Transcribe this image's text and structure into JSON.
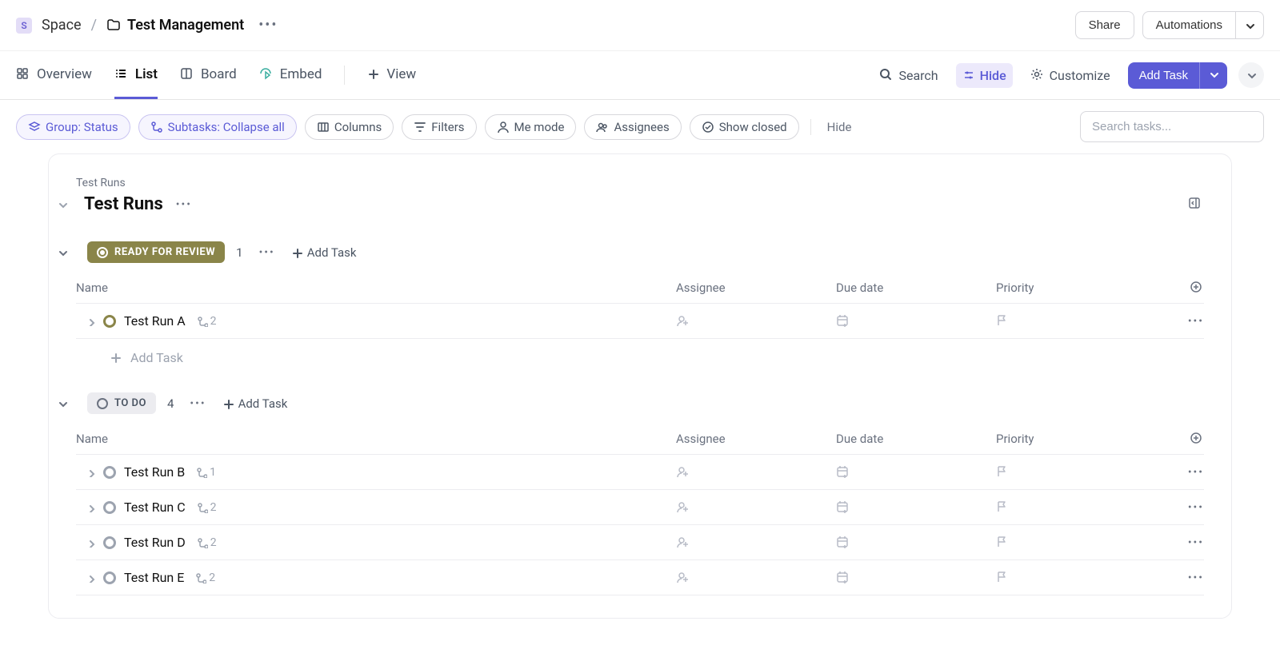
{
  "breadcrumb": {
    "space_badge": "S",
    "space_label": "Space",
    "folder_label": "Test Management"
  },
  "topbar": {
    "share_label": "Share",
    "automations_label": "Automations"
  },
  "viewtabs": {
    "overview": "Overview",
    "list": "List",
    "board": "Board",
    "embed": "Embed",
    "add_view": "View",
    "search": "Search",
    "hide": "Hide",
    "customize": "Customize",
    "add_task": "Add Task"
  },
  "filters": {
    "group": "Group: Status",
    "subtasks": "Subtasks: Collapse all",
    "columns": "Columns",
    "filters": "Filters",
    "me_mode": "Me mode",
    "assignees": "Assignees",
    "show_closed": "Show closed",
    "hide": "Hide",
    "search_placeholder": "Search tasks..."
  },
  "folder": {
    "crumb": "Test Runs",
    "title": "Test Runs"
  },
  "columns": {
    "name": "Name",
    "assignee": "Assignee",
    "due_date": "Due date",
    "priority": "Priority"
  },
  "groups": [
    {
      "status_label": "READY FOR REVIEW",
      "status_class": "review",
      "count": "1",
      "add_label": "Add Task",
      "tasks": [
        {
          "name": "Test Run A",
          "subtasks": "2",
          "status": "review"
        }
      ],
      "footer_add": "Add Task"
    },
    {
      "status_label": "TO DO",
      "status_class": "todo",
      "count": "4",
      "add_label": "Add Task",
      "tasks": [
        {
          "name": "Test Run B",
          "subtasks": "1",
          "status": "todo"
        },
        {
          "name": "Test Run C",
          "subtasks": "2",
          "status": "todo"
        },
        {
          "name": "Test Run D",
          "subtasks": "2",
          "status": "todo"
        },
        {
          "name": "Test Run E",
          "subtasks": "2",
          "status": "todo"
        }
      ]
    }
  ]
}
